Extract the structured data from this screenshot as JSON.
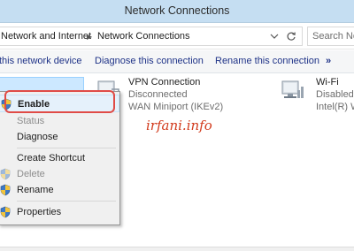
{
  "window": {
    "title": "Network Connections"
  },
  "address": {
    "crumbs": [
      "Network and Internet",
      "Network Connections"
    ],
    "search_placeholder": "Search Ne"
  },
  "toolbar": {
    "items": [
      "this network device",
      "Diagnose this connection",
      "Rename this connection",
      "»"
    ]
  },
  "connections": [
    {
      "name": "VPN Connection",
      "status": "Disconnected",
      "device": "WAN Miniport (IKEv2)"
    },
    {
      "name": "Wi-Fi",
      "status": "Disabled",
      "device": "Intel(R) W"
    }
  ],
  "context_menu": {
    "items": [
      {
        "label": "Enable",
        "icon": "shield-icon",
        "enabled": true
      },
      {
        "label": "Status",
        "icon": "",
        "enabled": false
      },
      {
        "label": "Diagnose",
        "icon": "",
        "enabled": true
      },
      {
        "label": "Create Shortcut",
        "icon": "",
        "enabled": true
      },
      {
        "label": "Delete",
        "icon": "shield-icon",
        "enabled": false
      },
      {
        "label": "Rename",
        "icon": "shield-icon",
        "enabled": true
      },
      {
        "label": "Properties",
        "icon": "shield-icon",
        "enabled": true
      }
    ]
  },
  "watermark": "irfani.info",
  "colors": {
    "highlight_ring": "#e04b46",
    "title_bar": "#c5def2",
    "link_text": "#1e3287"
  }
}
